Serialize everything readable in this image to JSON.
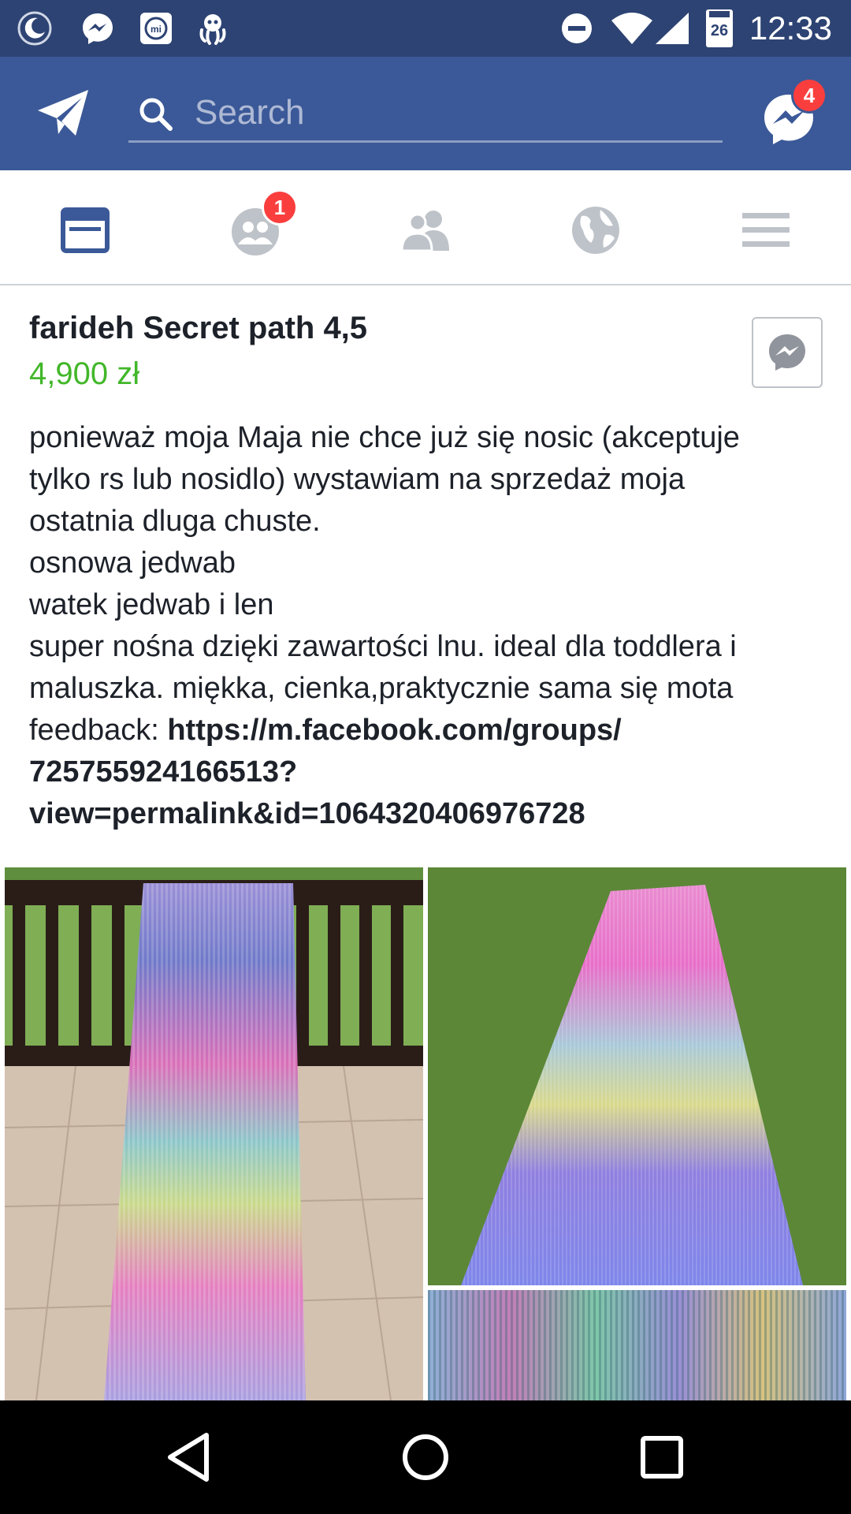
{
  "status_bar": {
    "time": "12:33",
    "calendar_day": "26",
    "icons": [
      "moon-icon",
      "messenger-icon",
      "mi-icon",
      "octopus-icon",
      "do-not-disturb-icon",
      "wifi-icon",
      "signal-icon",
      "calendar-icon"
    ]
  },
  "header": {
    "search_placeholder": "Search",
    "messenger_badge": "4"
  },
  "tabs": [
    {
      "name": "news-feed",
      "icon": "news-feed-icon",
      "active": true
    },
    {
      "name": "friend-requests",
      "icon": "friend-requests-icon",
      "badge": "1"
    },
    {
      "name": "groups",
      "icon": "groups-icon"
    },
    {
      "name": "notifications",
      "icon": "globe-icon"
    },
    {
      "name": "menu",
      "icon": "menu-icon"
    }
  ],
  "listing": {
    "title": "farideh Secret path 4,5",
    "price": "4,900 zł",
    "description_lines": [
      "ponieważ moja Maja nie chce już się nosic (akceptuje",
      "tylko rs lub nosidlo) wystawiam na sprzedaż moja",
      "ostatnia dluga chuste.",
      "osnowa jedwab",
      "watek jedwab i len",
      "super nośna dzięki zawartości lnu. ideal dla toddlera i",
      "maluszka. miękka, cienka,praktycznie sama się mota"
    ],
    "feedback_label": "feedback: ",
    "feedback_link_lines": [
      "https://m.facebook.com/groups/",
      "725755924166513?",
      "view=permalink&id=1064320406976728"
    ]
  },
  "colors": {
    "header_bg": "#3b5998",
    "status_bg": "#2d4373",
    "price": "#42b72a",
    "badge": "#fa3e3e",
    "active_tab": "#3b5998",
    "inactive_tab": "#bec3c9"
  }
}
